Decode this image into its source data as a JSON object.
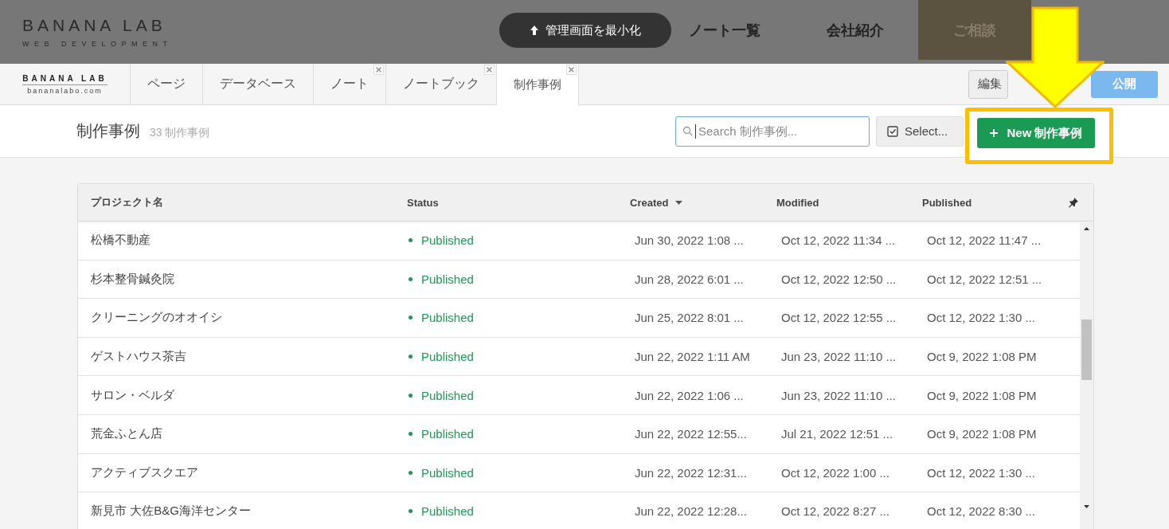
{
  "site_header": {
    "logo_title": "BANANA LAB",
    "logo_subtitle": "WEB DEVELOPMENT",
    "minimize_button": "管理画面を最小化",
    "nav": [
      {
        "label": "ノート一覧",
        "kind": "link"
      },
      {
        "label": "会社紹介",
        "kind": "link"
      },
      {
        "label": "ご相談",
        "kind": "cta"
      }
    ]
  },
  "admin_bar": {
    "logo_title": "BANANA LAB",
    "logo_subtitle": "bananalabo.com",
    "tabs": [
      {
        "label": "ページ",
        "selected": false,
        "closable": false
      },
      {
        "label": "データベース",
        "selected": false,
        "closable": false
      },
      {
        "label": "ノート",
        "selected": false,
        "closable": true
      },
      {
        "label": "ノートブック",
        "selected": false,
        "closable": true
      },
      {
        "label": "制作事例",
        "selected": true,
        "closable": true
      }
    ],
    "edit_button": "編集",
    "publish_button": "公開"
  },
  "toolbar": {
    "title": "制作事例",
    "count": "33 制作事例",
    "search": {
      "placeholder": "Search 制作事例..."
    },
    "select_button": "Select...",
    "new_button": "New 制作事例"
  },
  "table": {
    "columns": [
      {
        "label": "プロジェクト名",
        "sorted": false
      },
      {
        "label": "Status",
        "sorted": false
      },
      {
        "label": "Created",
        "sorted": true
      },
      {
        "label": "Modified",
        "sorted": false
      },
      {
        "label": "Published",
        "sorted": false
      }
    ],
    "rows": [
      {
        "name": "松橋不動産",
        "status": "Published",
        "created": "Jun 30, 2022 1:08 ...",
        "modified": "Oct 12, 2022 11:34 ...",
        "published": "Oct 12, 2022 11:47 ..."
      },
      {
        "name": "杉本整骨鍼灸院",
        "status": "Published",
        "created": "Jun 28, 2022 6:01 ...",
        "modified": "Oct 12, 2022 12:50 ...",
        "published": "Oct 12, 2022 12:51 ..."
      },
      {
        "name": "クリーニングのオオイシ",
        "status": "Published",
        "created": "Jun 25, 2022 8:01 ...",
        "modified": "Oct 12, 2022 12:55 ...",
        "published": "Oct 12, 2022 1:30 ..."
      },
      {
        "name": "ゲストハウス茶吉",
        "status": "Published",
        "created": "Jun 22, 2022 1:11 AM",
        "modified": "Jun 23, 2022 11:10 ...",
        "published": "Oct 9, 2022 1:08 PM"
      },
      {
        "name": "サロン・ベルダ",
        "status": "Published",
        "created": "Jun 22, 2022 1:06 ...",
        "modified": "Jun 23, 2022 11:10 ...",
        "published": "Oct 9, 2022 1:08 PM"
      },
      {
        "name": "荒金ふとん店",
        "status": "Published",
        "created": "Jun 22, 2022 12:55...",
        "modified": "Jul 21, 2022 12:51 ...",
        "published": "Oct 9, 2022 1:08 PM"
      },
      {
        "name": "アクティブスクエア",
        "status": "Published",
        "created": "Jun 22, 2022 12:31...",
        "modified": "Oct 12, 2022 1:00 ...",
        "published": "Oct 12, 2022 1:30 ..."
      },
      {
        "name": "新見市 大佐B&G海洋センター",
        "status": "Published",
        "created": "Jun 22, 2022 12:28...",
        "modified": "Oct 12, 2022 8:27 ...",
        "published": "Oct 12, 2022 8:30 ..."
      }
    ]
  }
}
